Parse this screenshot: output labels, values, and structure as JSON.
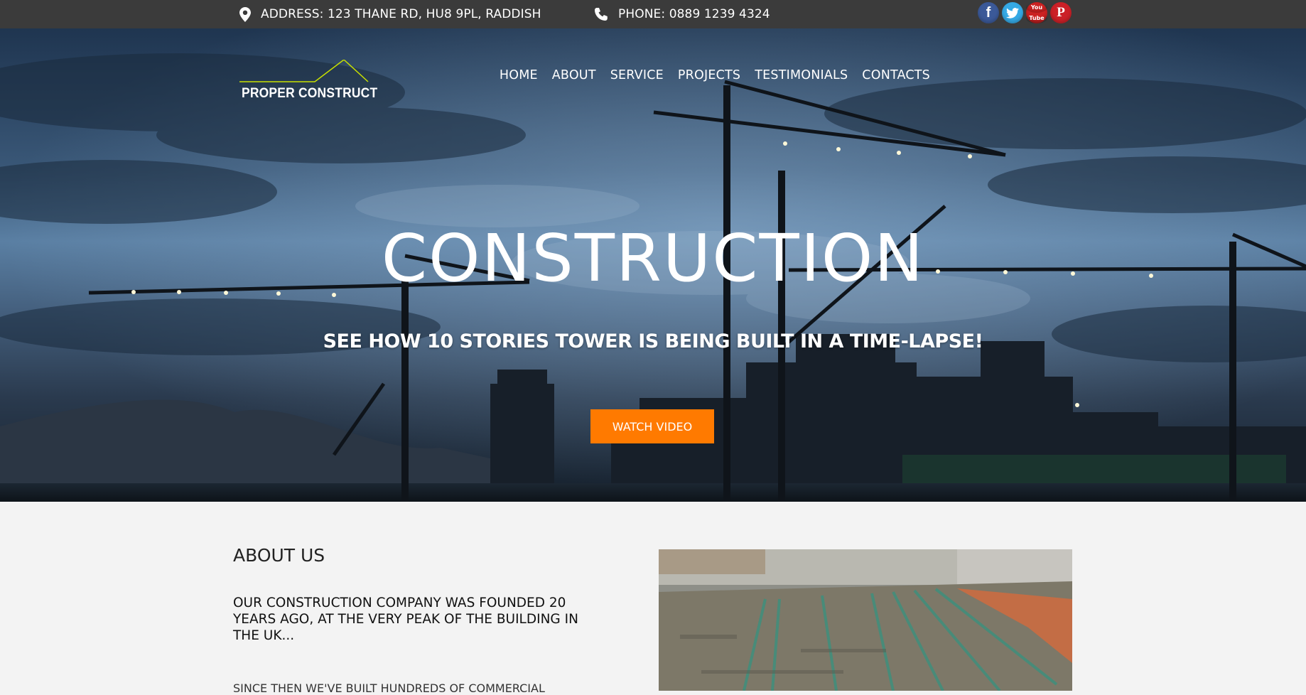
{
  "topbar": {
    "address": "ADDRESS: 123 THANE RD, HU8 9PL, RADDISH",
    "phone": "PHONE: 0889 1239 4324",
    "social": [
      "facebook-icon",
      "twitter-icon",
      "youtube-icon",
      "pinterest-icon"
    ],
    "youtube_text_top": "You",
    "youtube_text_bottom": "Tube"
  },
  "brand": {
    "logo_text": "PROPER CONSTRUCT",
    "accent": "#c8e000"
  },
  "nav": [
    "HOME",
    "ABOUT",
    "SERVICE",
    "PROJECTS",
    "TESTIMONIALS",
    "CONTACTS"
  ],
  "hero": {
    "title": "CONSTRUCTION",
    "subtitle": "SEE HOW 10 STORIES TOWER IS BEING BUILT IN A TIME-LAPSE!",
    "button": "WATCH VIDEO",
    "button_color": "#ff7a00"
  },
  "about": {
    "title": "ABOUT US",
    "lead": "OUR CONSTRUCTION COMPANY WAS FOUNDED 20 YEARS AGO, AT THE VERY PEAK OF THE BUILDING IN THE UK...",
    "body": "SINCE THEN WE'VE BUILT HUNDREDS OF COMMERCIAL"
  }
}
